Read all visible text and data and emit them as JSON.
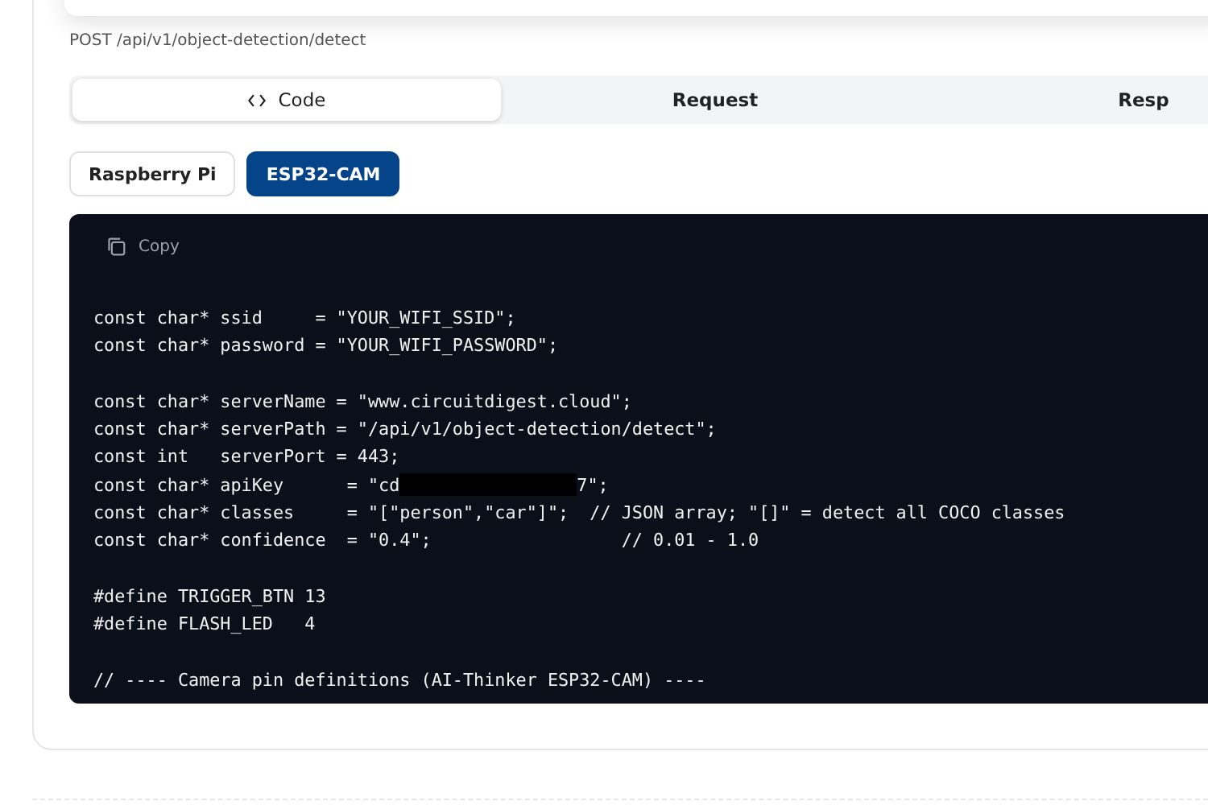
{
  "endpoint": "POST /api/v1/object-detection/detect",
  "tabs": [
    {
      "label": "Code",
      "selected": true
    },
    {
      "label": "Request",
      "selected": false
    },
    {
      "label": "Resp",
      "selected": false
    }
  ],
  "platforms": [
    {
      "label": "Raspberry Pi",
      "selected": false
    },
    {
      "label": "ESP32-CAM",
      "selected": true
    }
  ],
  "code_block": {
    "copy_label": "Copy",
    "lines": [
      {
        "kind": "code",
        "text": "const char* ssid     = \"YOUR_WIFI_SSID\";"
      },
      {
        "kind": "code",
        "text": "const char* password = \"YOUR_WIFI_PASSWORD\";"
      },
      {
        "kind": "blank"
      },
      {
        "kind": "code",
        "text": "const char* serverName = \"www.circuitdigest.cloud\";"
      },
      {
        "kind": "code",
        "text": "const char* serverPath = \"/api/v1/object-detection/detect\";"
      },
      {
        "kind": "code",
        "text": "const int   serverPort = 443;"
      },
      {
        "kind": "redacted",
        "before": "const char* apiKey      = \"cd",
        "after": "7\";"
      },
      {
        "kind": "code",
        "text": "const char* classes     = \"[\"person\",\"car\"]\";  // JSON array; \"[]\" = detect all COCO classes"
      },
      {
        "kind": "code",
        "text": "const char* confidence  = \"0.4\";                  // 0.01 - 1.0"
      },
      {
        "kind": "blank"
      },
      {
        "kind": "code",
        "text": "#define TRIGGER_BTN 13"
      },
      {
        "kind": "code",
        "text": "#define FLASH_LED   4"
      },
      {
        "kind": "blank"
      },
      {
        "kind": "code",
        "text": "// ---- Camera pin definitions (AI-Thinker ESP32-CAM) ----"
      }
    ]
  }
}
